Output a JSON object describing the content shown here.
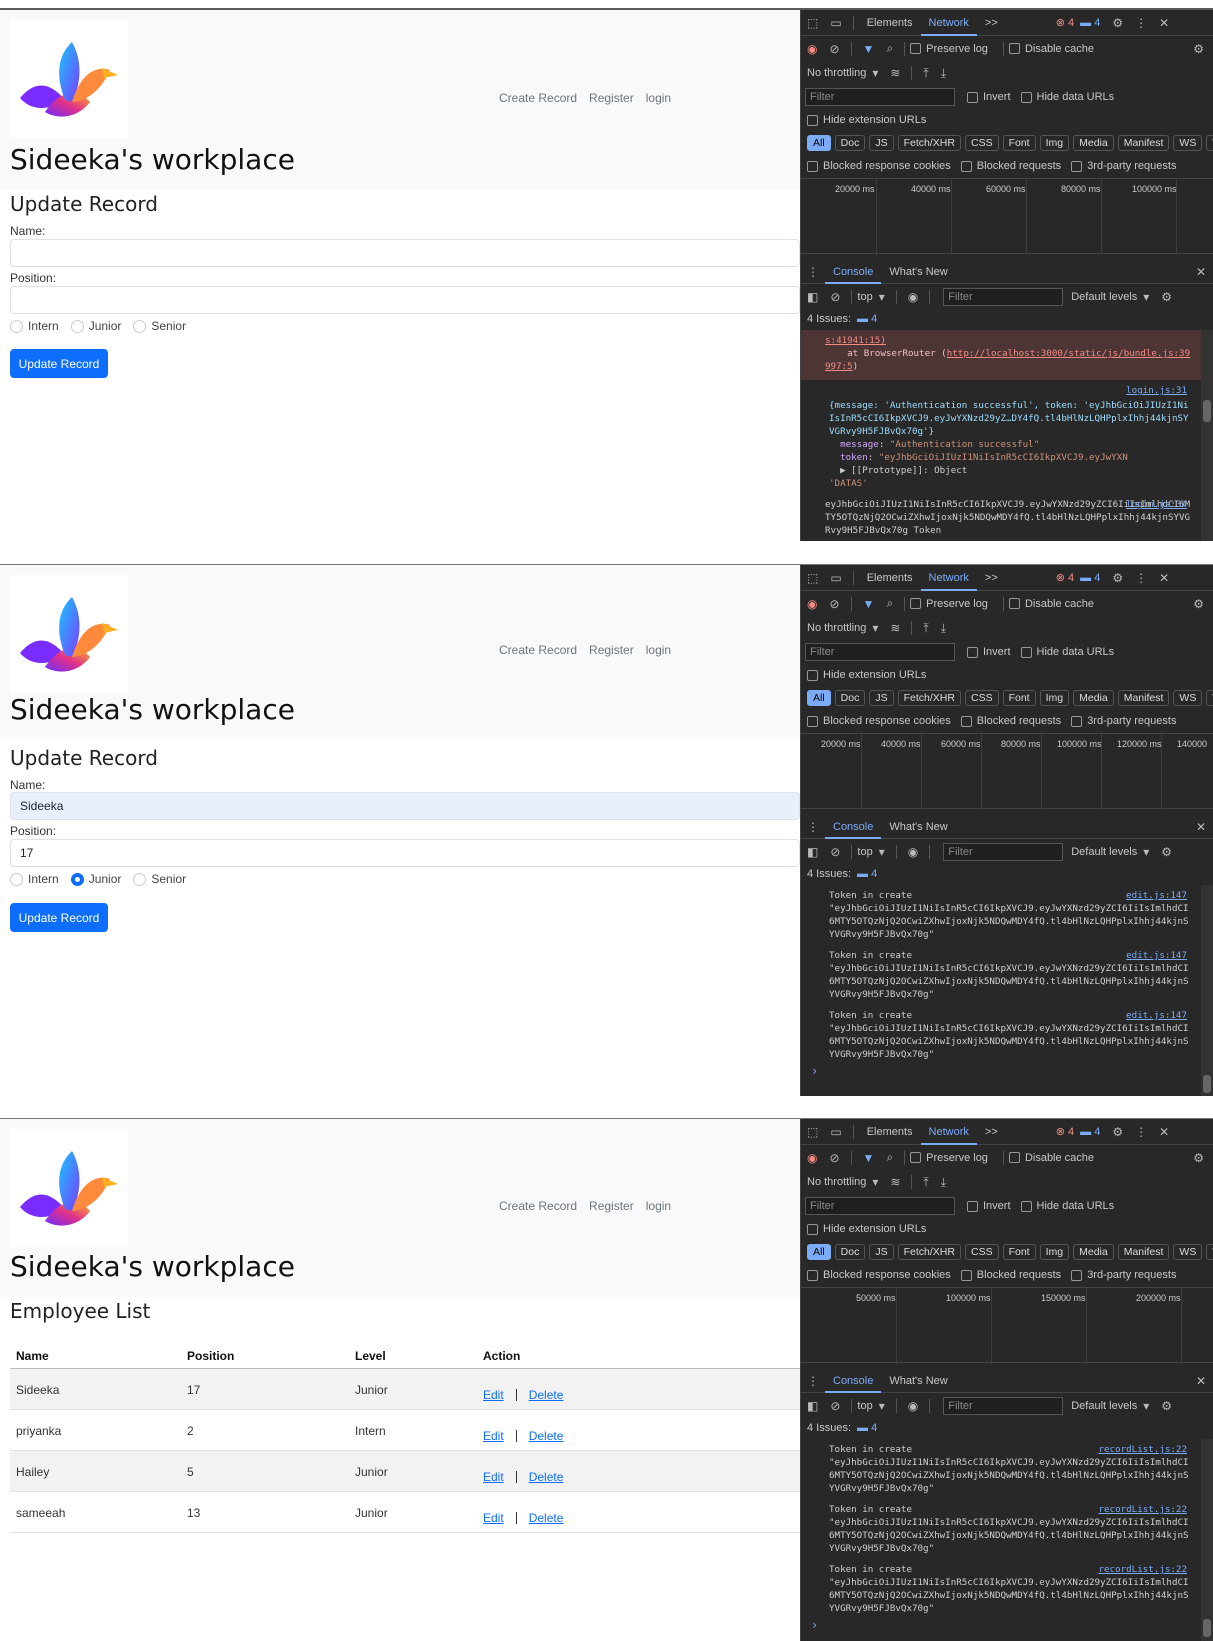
{
  "app": {
    "nav": [
      "Create Record",
      "Register",
      "login"
    ],
    "brand": "Sideeka's workplace"
  },
  "panel1": {
    "form_title": "Update Record",
    "name_label": "Name:",
    "name_value": "",
    "position_label": "Position:",
    "position_value": "",
    "levels": [
      "Intern",
      "Junior",
      "Senior"
    ],
    "selected_level": "",
    "button": "Update Record"
  },
  "panel2": {
    "form_title": "Update Record",
    "name_label": "Name:",
    "name_value": "Sideeka",
    "position_label": "Position:",
    "position_value": "17",
    "levels": [
      "Intern",
      "Junior",
      "Senior"
    ],
    "selected_level": "Junior",
    "button": "Update Record"
  },
  "panel3": {
    "list_title": "Employee List",
    "columns": [
      "Name",
      "Position",
      "Level",
      "Action"
    ],
    "rows": [
      {
        "name": "Sideeka",
        "position": "17",
        "level": "Junior"
      },
      {
        "name": "priyanka",
        "position": "2",
        "level": "Intern"
      },
      {
        "name": "Hailey",
        "position": "5",
        "level": "Junior"
      },
      {
        "name": "sameeah",
        "position": "13",
        "level": "Junior"
      }
    ],
    "edit": "Edit",
    "delete": "Delete"
  },
  "devtools": {
    "tabs": [
      "Elements",
      "Network"
    ],
    "more": ">>",
    "errors": "4",
    "messages": "4",
    "preserve_log": "Preserve log",
    "disable_cache": "Disable cache",
    "throttling": "No throttling",
    "filter_placeholder": "Filter",
    "invert": "Invert",
    "hide_data_urls": "Hide data URLs",
    "hide_extension_urls": "Hide extension URLs",
    "type_filters": [
      "All",
      "Doc",
      "JS",
      "Fetch/XHR",
      "CSS",
      "Font",
      "Img",
      "Media",
      "Manifest",
      "WS",
      "Wa"
    ],
    "blocked_cookies": "Blocked response cookies",
    "blocked_requests": "Blocked requests",
    "third_party": "3rd-party requests",
    "console_tabs": [
      "Console",
      "What's New"
    ],
    "context": "top",
    "levels": "Default levels",
    "issues": "4 Issues:",
    "issues_count": "4"
  },
  "timelines": {
    "p1": [
      "20000 ms",
      "40000 ms",
      "60000 ms",
      "80000 ms",
      "100000 ms"
    ],
    "p2": [
      "20000 ms",
      "40000 ms",
      "60000 ms",
      "80000 ms",
      "100000 ms",
      "120000 ms",
      "140000"
    ],
    "p3": [
      "50000 ms",
      "100000 ms",
      "150000 ms",
      "200000 ms"
    ]
  },
  "console1": {
    "err_line1": "s:41941:15)",
    "err_line2": "    at BrowserRouter (",
    "err_link": "http://localhost:3000/static/js/bundle.js:39997:5",
    "err_close": ")",
    "src1": "login.js:31",
    "obj_summary": "{message: 'Authentication successful', token: 'eyJhbGciOiJIUzI1NiIsInR5cCI6IkpXVCJ9.eyJwYXNzd29yZ…DY4fQ.tl4bHlNzLQHPplxIhhj44kjnSYVGRvy9H5FJBvQx70g'}",
    "msg_key": "message",
    "msg_val": "\"Authentication successful\"",
    "tok_key": "token",
    "tok_val": "\"eyJhbGciOiJIUzI1NiIsInR5cCI6IkpXVCJ9.eyJwYXN",
    "proto": "▶ [[Prototype]]: Object",
    "datas": "'DATAS'",
    "src2": "login.js:34",
    "token_line": "eyJhbGciOiJIUzI1NiIsInR5cCI6IkpXVCJ9.eyJwYXNzd29yZCI6IiIsImlhdCI6MTY5OTQzNjQ2OCwiZXhwIjoxNjk5NDQwMDY4fQ.tl4bHlNzLQHPplxIhhj44kjnSYVGRvy9H5FJBvQx70g Token"
  },
  "console2": {
    "label": "Token in create",
    "src": "edit.js:147",
    "token": "\"eyJhbGciOiJIUzI1NiIsInR5cCI6IkpXVCJ9.eyJwYXNzd29yZCI6IiIsImlhdCI6MTY5OTQzNjQ2OCwiZXhwIjoxNjk5NDQwMDY4fQ.tl4bHlNzLQHPplxIhhj44kjnSYVGRvy9H5FJBvQx70g\""
  },
  "console3": {
    "label": "Token in create",
    "src": "recordList.js:22",
    "token": "\"eyJhbGciOiJIUzI1NiIsInR5cCI6IkpXVCJ9.eyJwYXNzd29yZCI6IiIsImlhdCI6MTY5OTQzNjQ2OCwiZXhwIjoxNjk5NDQwMDY4fQ.tl4bHlNzLQHPplxIhhj44kjnSYVGRvy9H5FJBvQx70g\""
  },
  "colors": {
    "accent": "#0d6efd",
    "devtools_bg": "#282828",
    "devtools_link": "#7cacf8",
    "error": "#f28b82"
  }
}
